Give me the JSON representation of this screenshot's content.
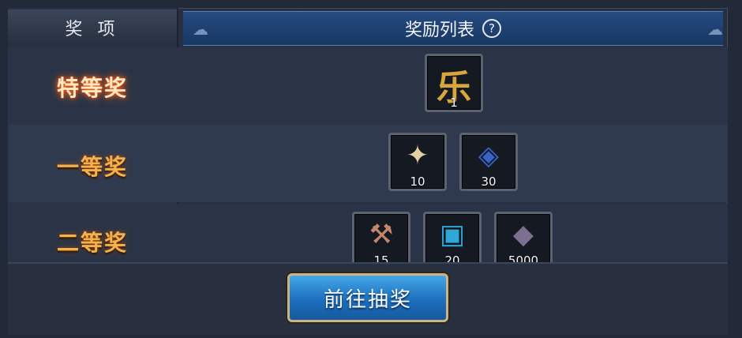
{
  "header": {
    "left_title": "奖 项",
    "right_title": "奖励列表",
    "help_glyph": "?"
  },
  "tiers": [
    {
      "label": "特等奖",
      "items": [
        {
          "icon": "le-glyph-icon",
          "glyph": "乐",
          "qty": "1",
          "color": "#d9a63c"
        }
      ]
    },
    {
      "label": "一等奖",
      "items": [
        {
          "icon": "jade-charm-icon",
          "glyph": "✦",
          "qty": "10",
          "color": "#e3d2a2"
        },
        {
          "icon": "sapphire-emblem-icon",
          "glyph": "◈",
          "qty": "30",
          "color": "#3a63c7"
        }
      ]
    },
    {
      "label": "二等奖",
      "items": [
        {
          "icon": "anvil-hammer-icon",
          "glyph": "⚒",
          "qty": "15",
          "color": "#c2876b"
        },
        {
          "icon": "blue-scroll-icon",
          "glyph": "▣",
          "qty": "20",
          "color": "#2fa8d8"
        },
        {
          "icon": "purple-ore-icon",
          "glyph": "◆",
          "qty": "5000",
          "color": "#7d6f8f"
        }
      ]
    }
  ],
  "button": {
    "label": "前往抽奖"
  }
}
